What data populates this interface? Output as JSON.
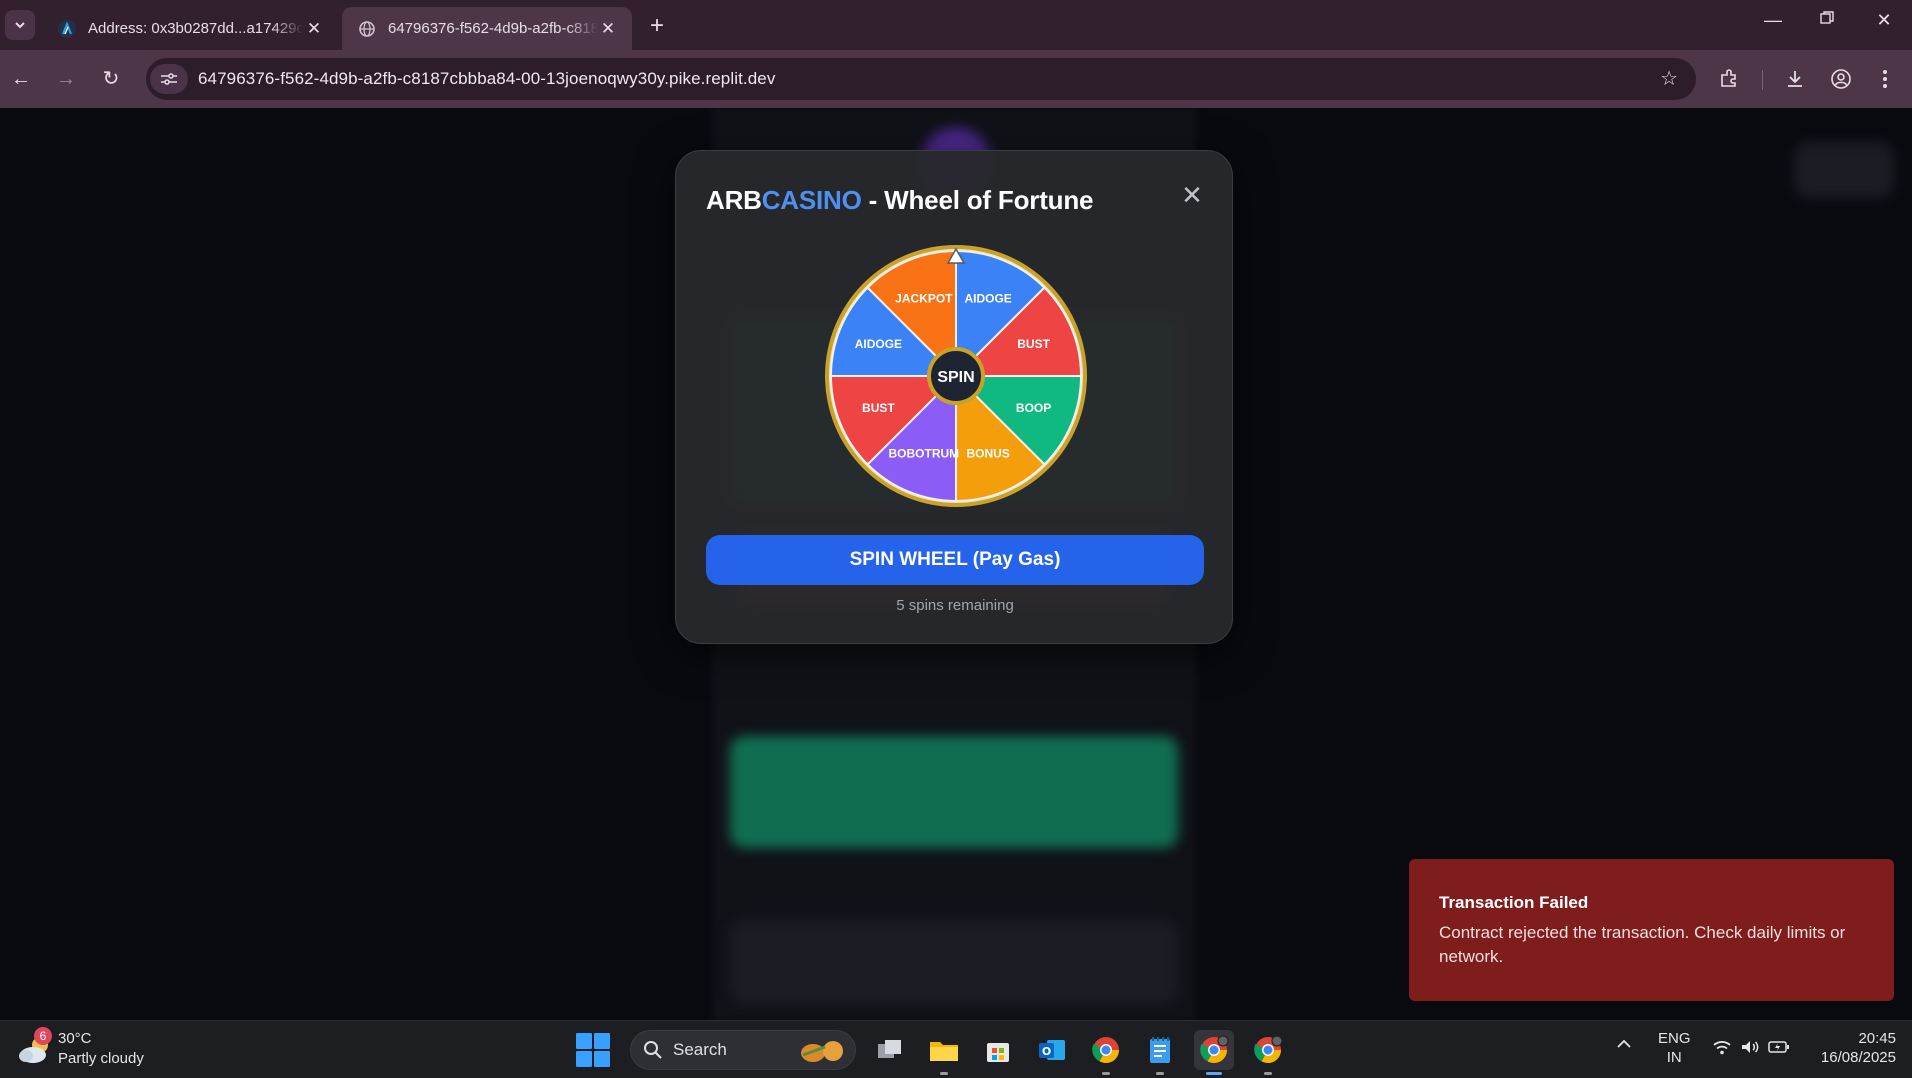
{
  "browser": {
    "tabs": [
      {
        "title": "Address: 0x3b0287dd...a17429c",
        "active": false
      },
      {
        "title": "64796376-f562-4d9b-a2fb-c8187",
        "active": true
      }
    ],
    "url": "64796376-f562-4d9b-a2fb-c8187cbbba84-00-13joenoqwy30y.pike.replit.dev"
  },
  "modal": {
    "title_prefix": "ARB",
    "title_accent": "CASINO",
    "title_suffix": " - Wheel of Fortune",
    "spin_center_label": "SPIN",
    "spin_button_label": "SPIN WHEEL (Pay Gas)",
    "spins_remaining": "5 spins remaining"
  },
  "wheel": {
    "segments": [
      {
        "label": "AIDOGE",
        "color": "#3b82f6"
      },
      {
        "label": "BUST",
        "color": "#ef4444"
      },
      {
        "label": "BOOP",
        "color": "#10b981"
      },
      {
        "label": "BONUS",
        "color": "#f59e0b"
      },
      {
        "label": "BOBOTRUM",
        "color": "#8b5cf6"
      },
      {
        "label": "BUST",
        "color": "#ef4444"
      },
      {
        "label": "AIDOGE",
        "color": "#3b82f6"
      },
      {
        "label": "JACKPOT",
        "color": "#f97316"
      }
    ],
    "rim_color": "#c9a227"
  },
  "toast": {
    "title": "Transaction Failed",
    "message": "Contract rejected the transaction. Check daily limits or network."
  },
  "taskbar": {
    "weather_badge": "6",
    "temperature": "30°C",
    "condition": "Partly cloudy",
    "search_label": "Search",
    "language_line1": "ENG",
    "language_line2": "IN",
    "time": "20:45",
    "date": "16/08/2025"
  }
}
